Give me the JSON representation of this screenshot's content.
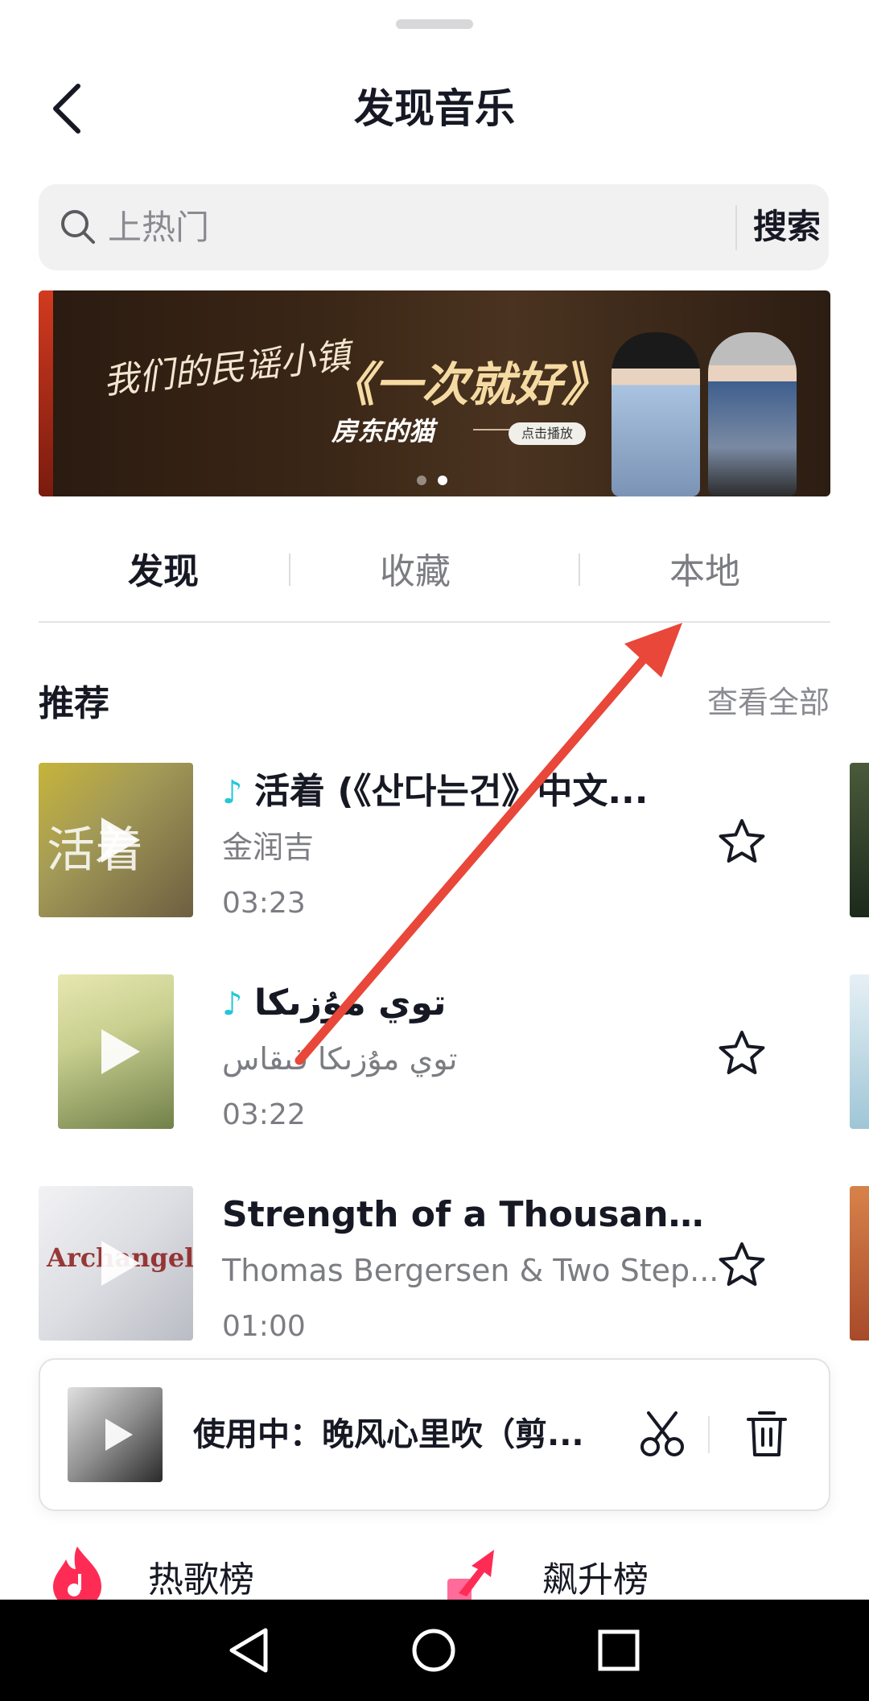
{
  "header": {
    "title": "发现音乐"
  },
  "search": {
    "placeholder": "上热门",
    "button_label": "搜索"
  },
  "banner": {
    "left_text": "我们的民谣小镇",
    "song": "《一次就好》",
    "artist": "房东的猫",
    "play_tag": "点击播放",
    "page_count": 2,
    "active_page": 2
  },
  "tabs": [
    {
      "label": "发现",
      "active": true
    },
    {
      "label": "收藏",
      "active": false
    },
    {
      "label": "本地",
      "active": false
    }
  ],
  "section": {
    "title": "推荐",
    "see_all": "查看全部"
  },
  "songs": [
    {
      "title": "活着 (《산다는건》中文...",
      "artist": "金润吉",
      "duration": "03:23",
      "cover_text": "活着",
      "douyin_badge": true
    },
    {
      "title": "توي مۇزىكا",
      "artist": "توي مۇزىكا قىقاس",
      "duration": "03:22",
      "cover_text": "",
      "douyin_badge": true
    },
    {
      "title": "Strength of a Thousand ...",
      "artist": "Thomas Bergersen & Two Step...",
      "duration": "01:00",
      "cover_text": "Archangel",
      "douyin_badge": false
    }
  ],
  "now_playing": {
    "text": "使用中：晚风心里吹（剪..."
  },
  "charts": [
    {
      "label": "热歌榜",
      "icon": "flame-music-icon"
    },
    {
      "label": "飙升榜",
      "icon": "rising-arrow-icon"
    }
  ],
  "colors": {
    "accent_annotation": "#e8473a",
    "douyin_note": "#25c6d6",
    "hot_chart": "#fe2c55",
    "text_primary": "#161823",
    "text_secondary": "#7c7d82"
  }
}
